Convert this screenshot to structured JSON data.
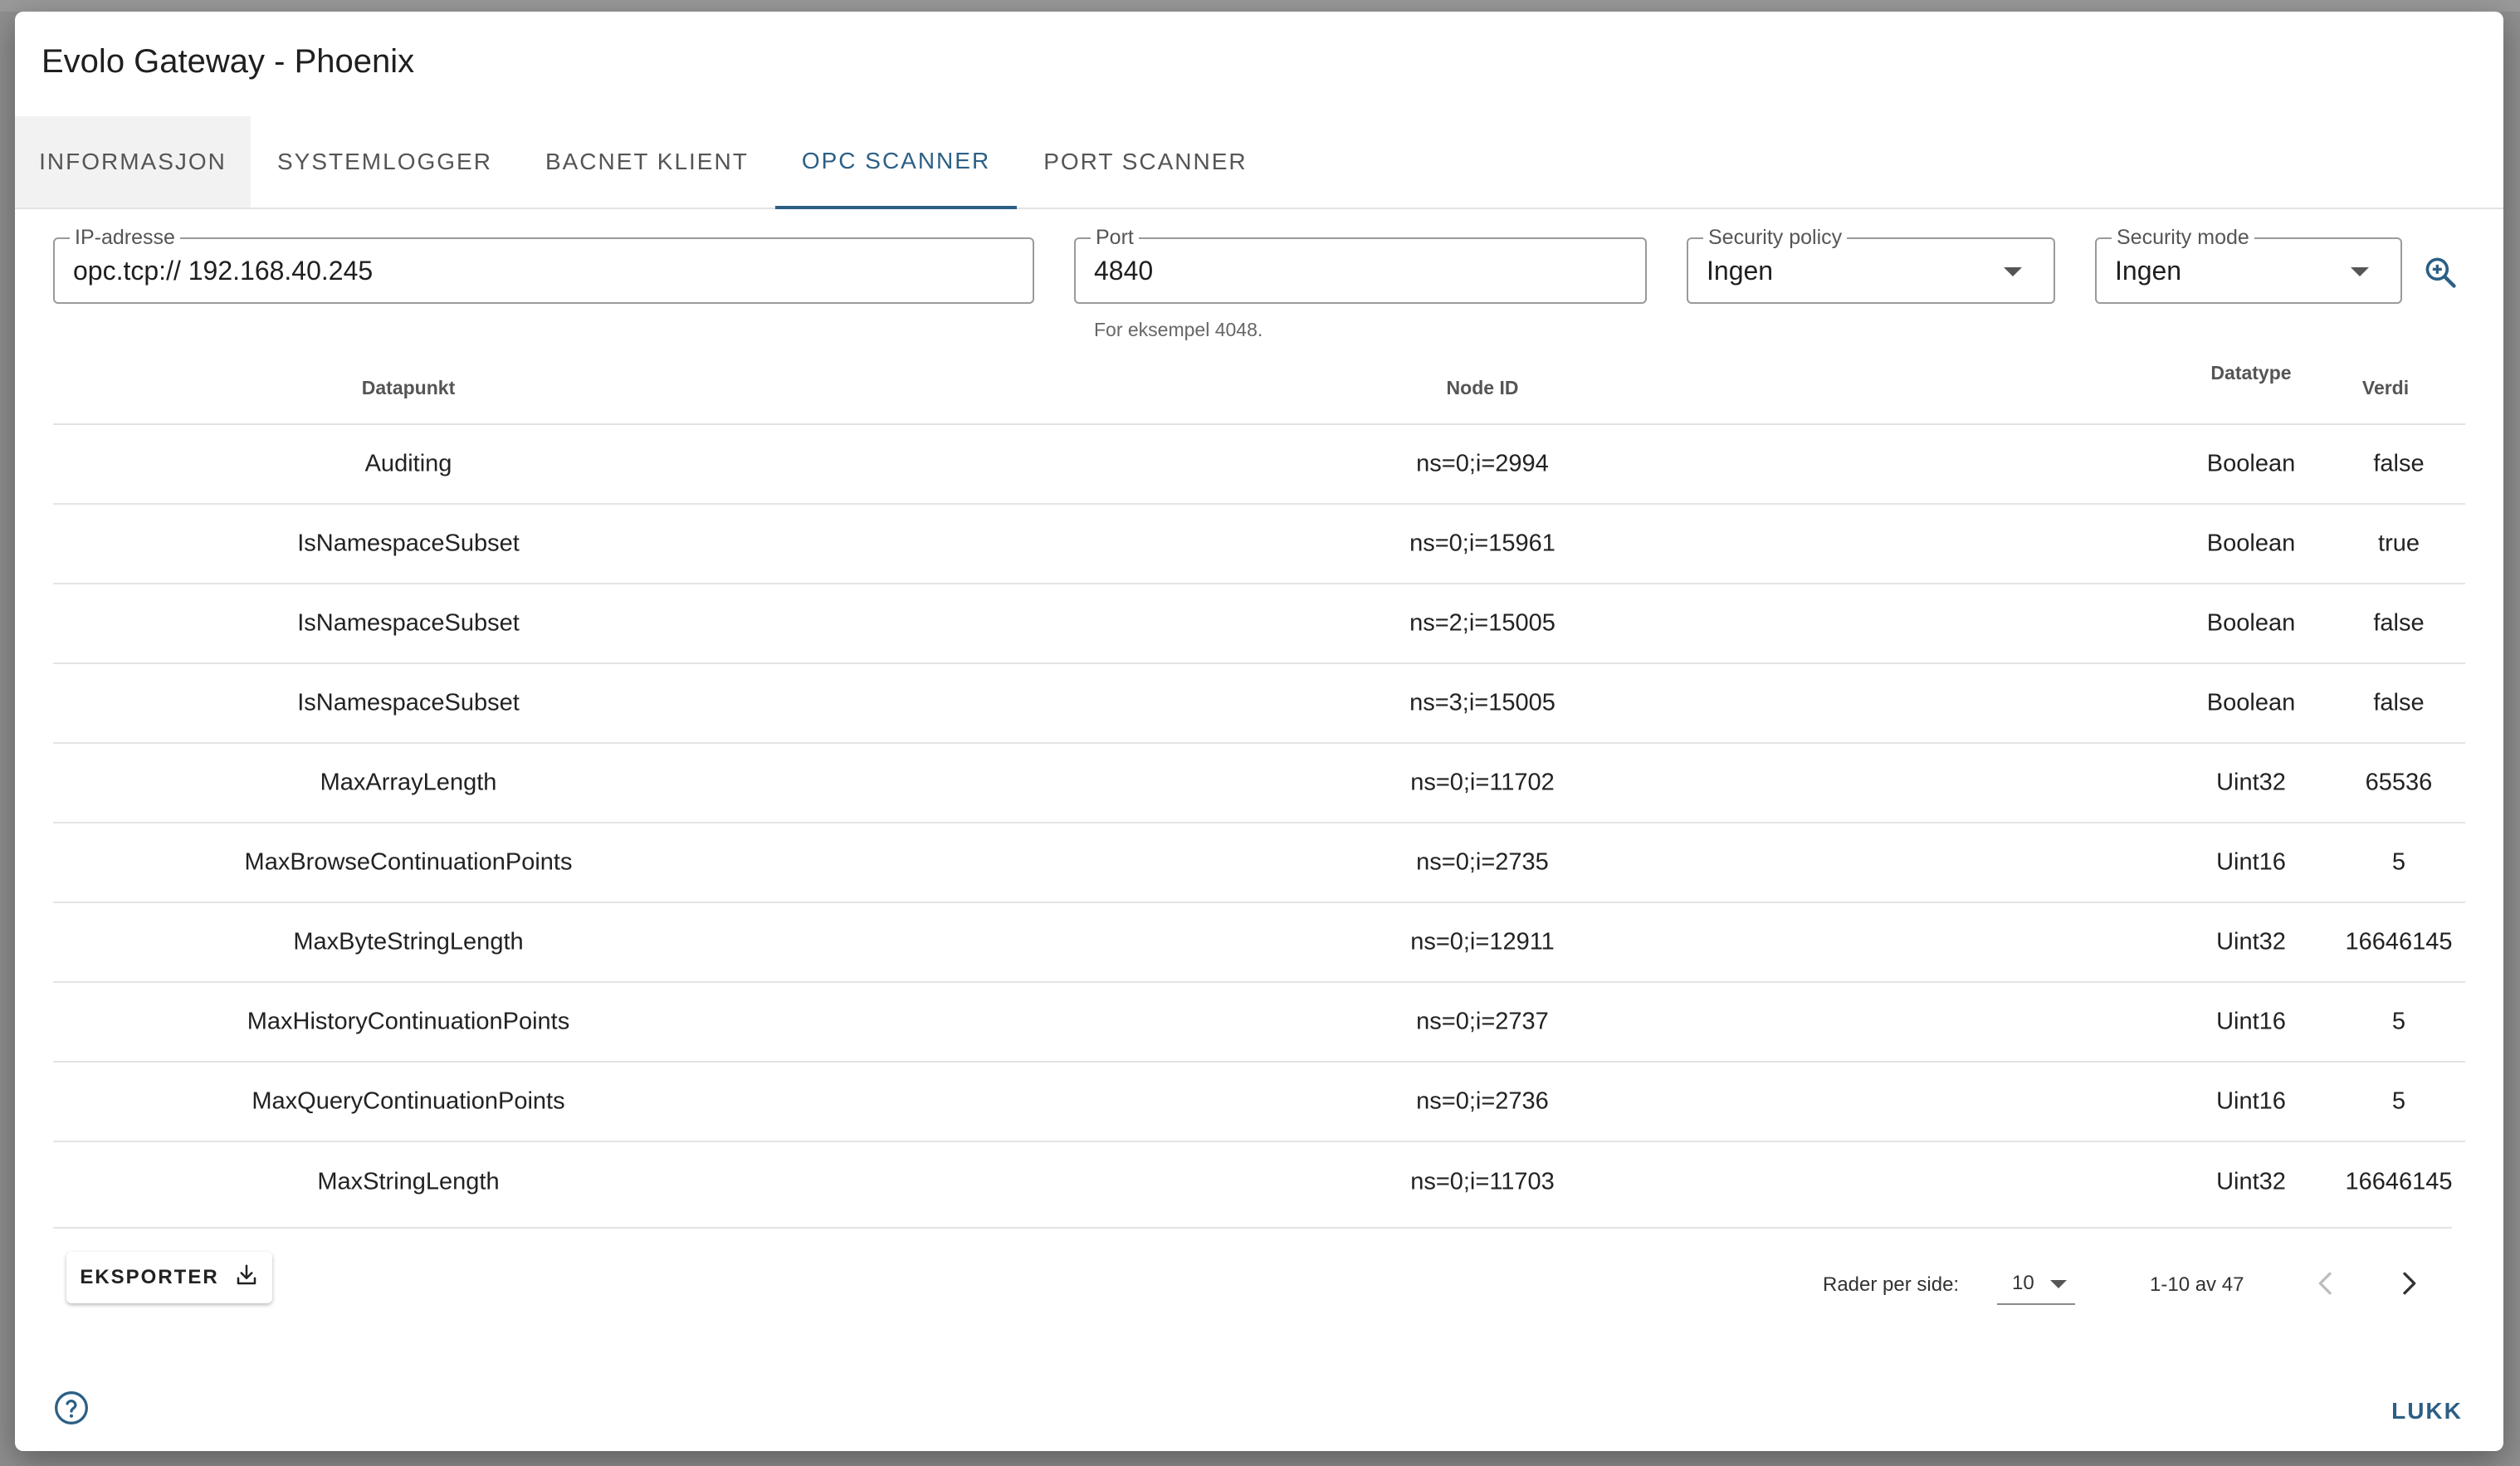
{
  "dialog": {
    "title": "Evolo Gateway - Phoenix"
  },
  "tabs": [
    {
      "label": "INFORMASJON"
    },
    {
      "label": "SYSTEMLOGGER"
    },
    {
      "label": "BACNET KLIENT"
    },
    {
      "label": "OPC SCANNER"
    },
    {
      "label": "PORT SCANNER"
    }
  ],
  "form": {
    "ip": {
      "label": "IP-adresse",
      "value": "opc.tcp:// 192.168.40.245"
    },
    "port": {
      "label": "Port",
      "value": "4840",
      "helper": "For eksempel 4048."
    },
    "security_policy": {
      "label": "Security policy",
      "value": "Ingen"
    },
    "security_mode": {
      "label": "Security mode",
      "value": "Ingen"
    },
    "search_icon": "zoom-in-icon"
  },
  "table": {
    "headers": {
      "datapunkt": "Datapunkt",
      "node_id": "Node ID",
      "datatype": "Datatype",
      "verdi": "Verdi"
    },
    "rows": [
      {
        "datapunkt": "Auditing",
        "node_id": "ns=0;i=2994",
        "datatype": "Boolean",
        "verdi": "false"
      },
      {
        "datapunkt": "IsNamespaceSubset",
        "node_id": "ns=0;i=15961",
        "datatype": "Boolean",
        "verdi": "true"
      },
      {
        "datapunkt": "IsNamespaceSubset",
        "node_id": "ns=2;i=15005",
        "datatype": "Boolean",
        "verdi": "false"
      },
      {
        "datapunkt": "IsNamespaceSubset",
        "node_id": "ns=3;i=15005",
        "datatype": "Boolean",
        "verdi": "false"
      },
      {
        "datapunkt": "MaxArrayLength",
        "node_id": "ns=0;i=11702",
        "datatype": "Uint32",
        "verdi": "65536"
      },
      {
        "datapunkt": "MaxBrowseContinuationPoints",
        "node_id": "ns=0;i=2735",
        "datatype": "Uint16",
        "verdi": "5"
      },
      {
        "datapunkt": "MaxByteStringLength",
        "node_id": "ns=0;i=12911",
        "datatype": "Uint32",
        "verdi": "16646145"
      },
      {
        "datapunkt": "MaxHistoryContinuationPoints",
        "node_id": "ns=0;i=2737",
        "datatype": "Uint16",
        "verdi": "5"
      },
      {
        "datapunkt": "MaxQueryContinuationPoints",
        "node_id": "ns=0;i=2736",
        "datatype": "Uint16",
        "verdi": "5"
      },
      {
        "datapunkt": "MaxStringLength",
        "node_id": "ns=0;i=11703",
        "datatype": "Uint32",
        "verdi": "16646145"
      }
    ]
  },
  "footer": {
    "export_label": "EKSPORTER",
    "rows_per_page_label": "Rader per side:",
    "rows_per_page_value": "10",
    "range_text": "1-10 av 47",
    "close_label": "LUKK"
  },
  "colors": {
    "accent": "#2c5f85"
  }
}
